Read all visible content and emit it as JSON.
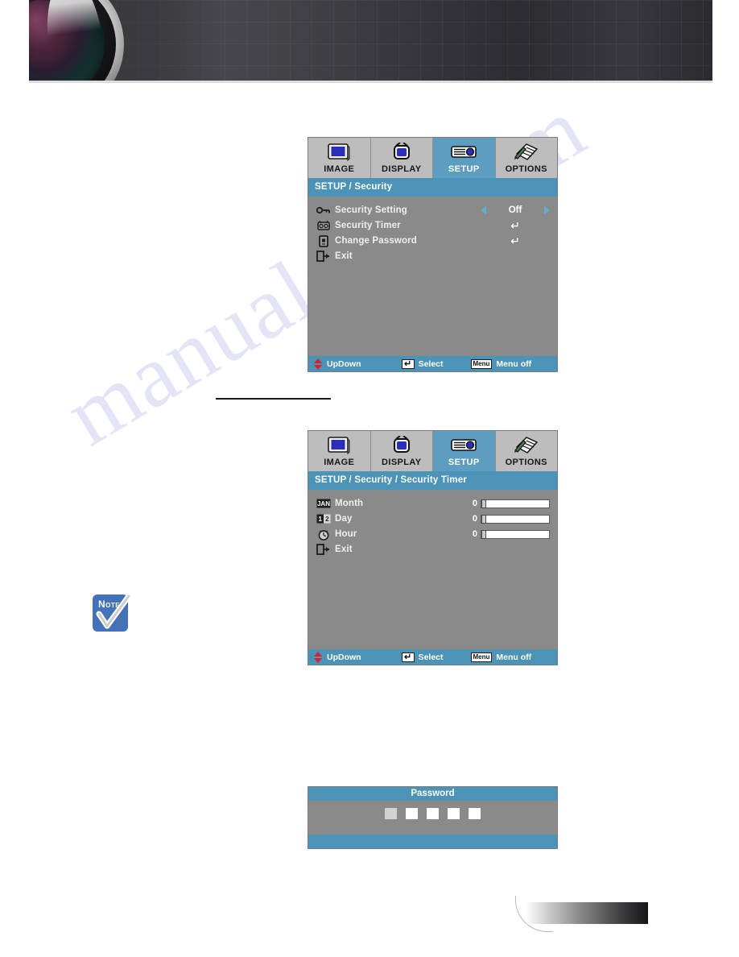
{
  "page": {
    "watermark": "manualslib.com"
  },
  "banner": {
    "lens_icon": "camera-lens-graphic"
  },
  "osd_tabs": [
    {
      "id": "image",
      "label": "IMAGE",
      "icon": "monitor-icon",
      "active": false
    },
    {
      "id": "display",
      "label": "DISPLAY",
      "icon": "tv-icon",
      "active": false
    },
    {
      "id": "setup",
      "label": "SETUP",
      "icon": "projector-icon",
      "active": true
    },
    {
      "id": "options",
      "label": "OPTIONS",
      "icon": "notes-pen-icon",
      "active": false
    }
  ],
  "security_menu": {
    "title": "SETUP / Security",
    "rows": [
      {
        "icon": "key-icon",
        "label": "Security Setting",
        "type": "select",
        "value": "Off"
      },
      {
        "icon": "clock-tag-icon",
        "label": "Security Timer",
        "type": "enter",
        "value": "↵"
      },
      {
        "icon": "password-icon",
        "label": "Change Password",
        "type": "enter",
        "value": "↵"
      },
      {
        "icon": "exit-icon",
        "label": "Exit",
        "type": "none",
        "value": ""
      }
    ],
    "footer": {
      "updown": "UpDown",
      "select": "Select",
      "enter_key": "↵",
      "menu_key": "Menu",
      "menu_off": "Menu off"
    }
  },
  "security_timer_menu": {
    "title": "SETUP / Security / Security Timer",
    "rows": [
      {
        "icon": "calendar-month-icon",
        "label": "Month",
        "type": "slider",
        "value": "0",
        "percent": 0
      },
      {
        "icon": "calendar-day-icon",
        "label": "Day",
        "type": "slider",
        "value": "0",
        "percent": 0
      },
      {
        "icon": "clock-hour-icon",
        "label": "Hour",
        "type": "slider",
        "value": "0",
        "percent": 0
      },
      {
        "icon": "exit-icon",
        "label": "Exit",
        "type": "none",
        "value": ""
      }
    ],
    "footer": {
      "updown": "UpDown",
      "select": "Select",
      "enter_key": "↵",
      "menu_key": "Menu",
      "menu_off": "Menu off"
    }
  },
  "password_dialog": {
    "title": "Password",
    "boxes": [
      {
        "filled": true
      },
      {
        "filled": false
      },
      {
        "filled": false
      },
      {
        "filled": false
      },
      {
        "filled": false
      }
    ]
  },
  "note": {
    "label": "Note",
    "icon": "note-checkmark-icon"
  },
  "colors": {
    "accent_blue": "#4b93b7",
    "tab_active_blue": "#5d9dc0",
    "panel_gray": "#8a8a8a",
    "tab_gray": "#bdbdbd",
    "arrow_blue": "#63aed6",
    "updown_red": "#e01f2a",
    "note_blue": "#4472b8"
  }
}
